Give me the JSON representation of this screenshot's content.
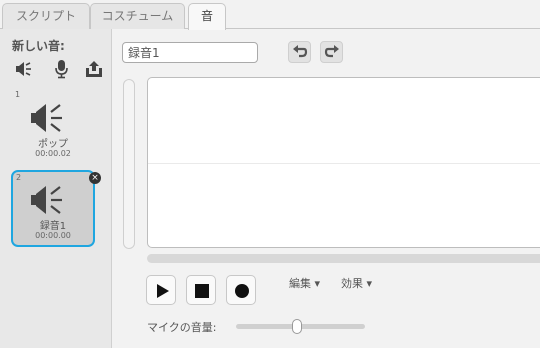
{
  "tabs": [
    {
      "label": "スクリプト",
      "active": false
    },
    {
      "label": "コスチューム",
      "active": false
    },
    {
      "label": "音",
      "active": true
    }
  ],
  "sidebar": {
    "new_sound_label": "新しい音:",
    "new_icons": [
      "speaker-library-icon",
      "microphone-icon",
      "upload-icon"
    ],
    "sounds": [
      {
        "index": "1",
        "name": "ポップ",
        "duration": "00:00.02",
        "selected": false
      },
      {
        "index": "2",
        "name": "録音1",
        "duration": "00:00.00",
        "selected": true
      }
    ],
    "delete_icon": "×"
  },
  "editor": {
    "sound_name_value": "録音1",
    "edit_menu": "編集 ▾",
    "effects_menu": "効果 ▾",
    "mic_volume_label": "マイクの音量:",
    "mic_volume_level": 0.47
  },
  "colors": {
    "selection_border": "#1fa6e0",
    "icon": "#444444"
  }
}
